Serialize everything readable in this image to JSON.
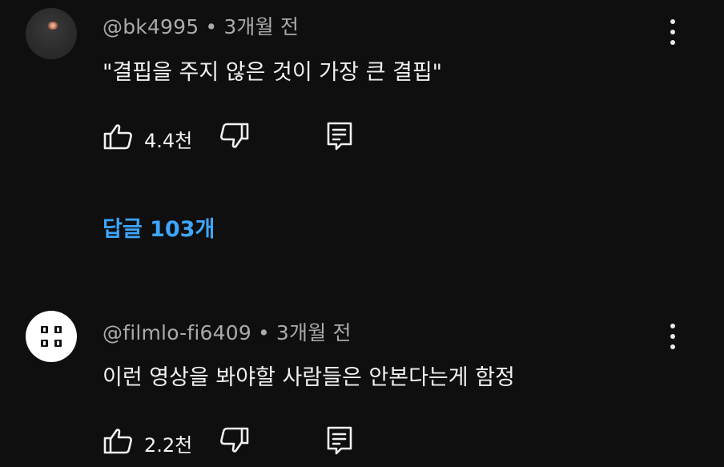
{
  "comments": [
    {
      "author": "@bk4995",
      "separator": "•",
      "time": "3개월 전",
      "text": "\"결핍을 주지 않은 것이 가장 큰 결핍\"",
      "likes": "4.4천",
      "replies_label": "답글 103개"
    },
    {
      "author": "@filmlo-fi6409",
      "separator": "•",
      "time": "3개월 전",
      "text": "이런 영상을 봐야할 사람들은 안본다는게 함정",
      "likes": "2.2천"
    }
  ],
  "colors": {
    "background": "#0f0f0f",
    "primary_text": "#f1f1f1",
    "secondary_text": "#aaaaaa",
    "link": "#3ea6ff"
  },
  "icons": [
    "thumb-up-icon",
    "thumb-down-icon",
    "reply-icon",
    "more-vert-icon"
  ]
}
